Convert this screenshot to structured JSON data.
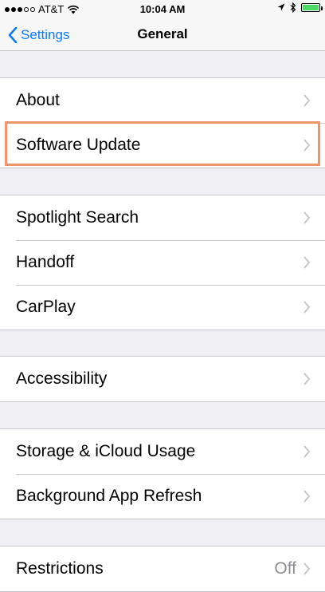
{
  "status_bar": {
    "carrier": "AT&T",
    "time": "10:04 AM",
    "signal_strength": 3,
    "signal_max": 5,
    "battery_color": "#4cd964"
  },
  "nav": {
    "back_label": "Settings",
    "title": "General"
  },
  "groups": [
    {
      "rows": [
        {
          "label": "About"
        },
        {
          "label": "Software Update"
        }
      ]
    },
    {
      "rows": [
        {
          "label": "Spotlight Search"
        },
        {
          "label": "Handoff"
        },
        {
          "label": "CarPlay"
        }
      ]
    },
    {
      "rows": [
        {
          "label": "Accessibility"
        }
      ]
    },
    {
      "rows": [
        {
          "label": "Storage & iCloud Usage"
        },
        {
          "label": "Background App Refresh"
        }
      ]
    },
    {
      "rows": [
        {
          "label": "Restrictions",
          "value": "Off"
        }
      ]
    }
  ],
  "highlight_color": "#f0956b",
  "accent_color": "#0a7aff"
}
